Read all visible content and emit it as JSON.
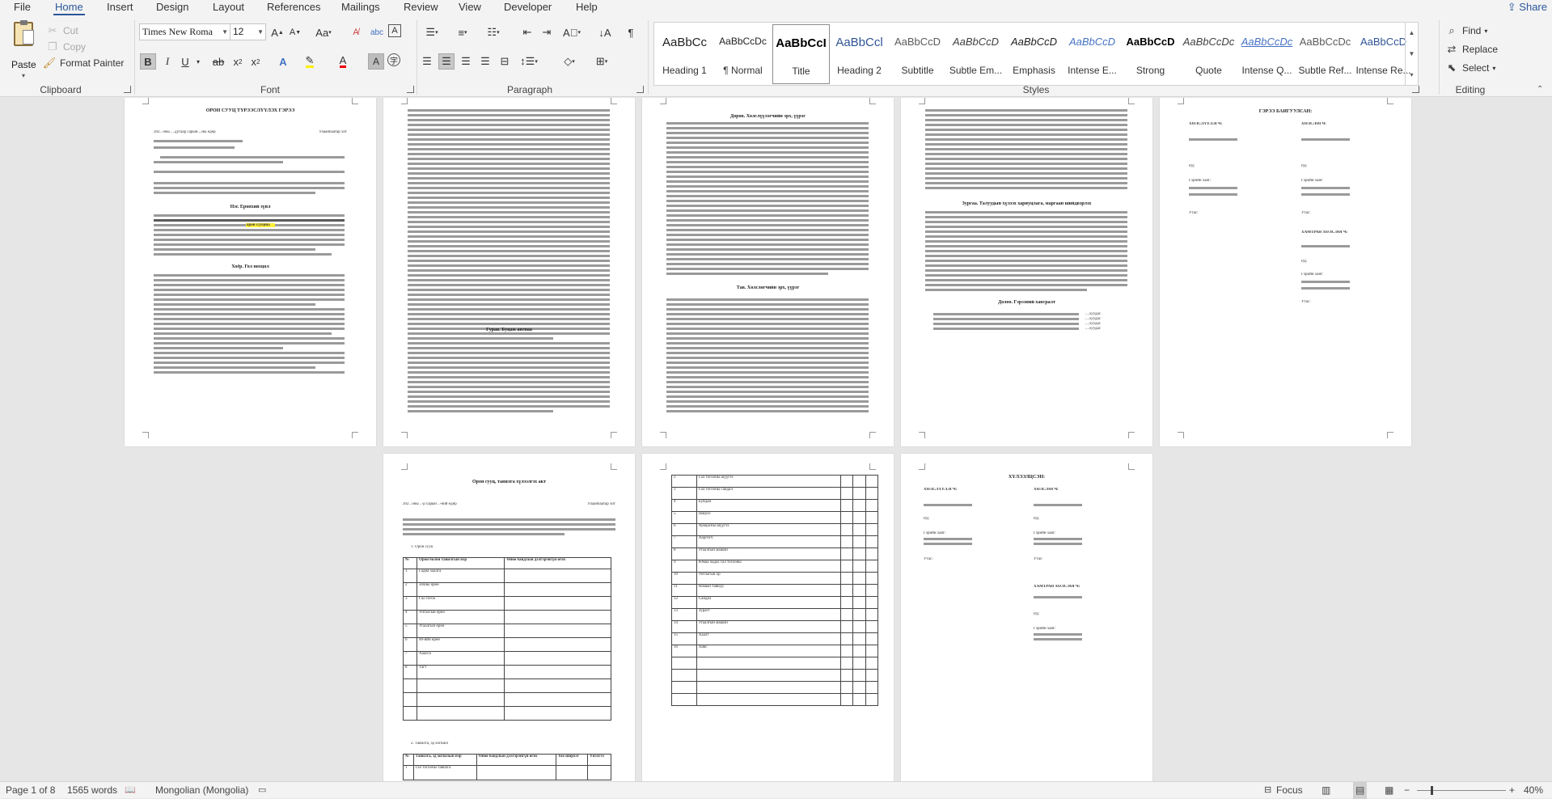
{
  "menu": {
    "tabs": [
      "File",
      "Home",
      "Insert",
      "Design",
      "Layout",
      "References",
      "Mailings",
      "Review",
      "View",
      "Developer",
      "Help"
    ],
    "active": "Home",
    "share": "Share"
  },
  "clipboard": {
    "paste": "Paste",
    "cut": "Cut",
    "copy": "Copy",
    "format_painter": "Format Painter",
    "label": "Clipboard"
  },
  "font": {
    "family": "Times New Roma",
    "size": "12",
    "label": "Font",
    "bold": "B",
    "italic": "I",
    "underline": "U",
    "aa": "Aa"
  },
  "paragraph": {
    "label": "Paragraph"
  },
  "styles": {
    "label": "Styles",
    "items": [
      {
        "preview": "AaBbCc",
        "name": "Heading 1",
        "color": "#1f1f1f"
      },
      {
        "preview": "AaBbCcDc",
        "name": "¶ Normal",
        "color": "#1f1f1f"
      },
      {
        "preview": "AaBbCcI",
        "name": "Title",
        "color": "#000000"
      },
      {
        "preview": "AaBbCcl",
        "name": "Heading 2",
        "color": "#2f5496"
      },
      {
        "preview": "AaBbCcD",
        "name": "Subtitle",
        "color": "#5a5a5a"
      },
      {
        "preview": "AaBbCcD",
        "name": "Subtle Em...",
        "color": "#404040"
      },
      {
        "preview": "AaBbCcD",
        "name": "Emphasis",
        "color": "#1f1f1f"
      },
      {
        "preview": "AaBbCcD",
        "name": "Intense E...",
        "color": "#4472c4"
      },
      {
        "preview": "AaBbCcD",
        "name": "Strong",
        "color": "#000000"
      },
      {
        "preview": "AaBbCcDc",
        "name": "Quote",
        "color": "#404040"
      },
      {
        "preview": "AaBbCcDc",
        "name": "Intense Q...",
        "color": "#4472c4"
      },
      {
        "preview": "AaBbCcDc",
        "name": "Subtle Ref...",
        "color": "#5a5a5a"
      },
      {
        "preview": "AaBbCcD",
        "name": "Intense Re...",
        "color": "#2f5496"
      }
    ]
  },
  "editing": {
    "label": "Editing",
    "find": "Find",
    "replace": "Replace",
    "select": "Select"
  },
  "pages": {
    "p1": {
      "title": "ОРОН СУУЦ ТҮРЭЭСЛҮҮЛЭХ ГЭРЭЭ",
      "date_line": "202.. оны ....дугаар сарын....ны өдөр",
      "place": "Улаанбаатар хот",
      "sec1": "Нэг. Ерөнхий зүйл",
      "sec2": "Хоёр. Гол нөхцөл",
      "highlight": "орон сууцны"
    },
    "p2": {
      "sec3": "Гурав. Буцаж авснаа"
    },
    "p3": {
      "sec4": "Дөрөв. Хөлслүүлэгчийн эрх, үүрэг",
      "sec5": "Тав. Хөлслөгчийн эрх, үүрэг"
    },
    "p4": {
      "sec6": "Зургаа. Талуудын хүлээх хариуцлага, маргаан шийдвэрлэх",
      "sec7": "Долоо. Гэрээний хавсралт",
      "items": [
        "....хуудас",
        "....хуудас",
        "....хуудас",
        "....хуудас"
      ]
    },
    "p5": {
      "title": "ГЭРЭЭ БАЙГУУЛСАН:",
      "left": "ХӨЛСЛҮҮЛЭГЧ:",
      "right": "ХӨЛСЛӨГЧ:",
      "rd": "РД:",
      "phone": "Гэрийн хаяг:",
      "sign": "Утас:",
      "third": "ХАМТРАН ХӨЛСЛӨГЧ:"
    },
    "p6": {
      "title": "Орон сууц, тавилга хүлээлгэх акт",
      "date_line": "202.. оны ..-р сарын ..-ний өдөр",
      "place": "Улаанбаатар хот",
      "list1": "1.   Орон сууц",
      "list2": "2.   Тавилга, эд хогшил",
      "t1_head": [
        "№",
        "Орон болон тавилгын нэр",
        "Өнөө байдлын дэлгэрэнгүй өгөх"
      ],
      "t1_rows": [
        [
          "1",
          "Гадна хаалга"
        ],
        [
          "2",
          "Зочны өрөө"
        ],
        [
          "3",
          "Гал тогоо"
        ],
        [
          "4",
          "Унтлагын өрөө"
        ],
        [
          "5",
          "Угаалгын өрөө"
        ],
        [
          "6",
          "00-ийн өрөө"
        ],
        [
          "7",
          "Хаалга"
        ],
        [
          "8",
          "Тагт"
        ]
      ],
      "t2_head": [
        "№",
        "Тавилга, эд хогшлын нэр",
        "Өнөө байдлын дэлгэрэнгүй өгөх",
        "Тоо ширхэг",
        "Үнэлгээ"
      ],
      "t2_rows": [
        [
          "1",
          "Гал тогооны тавилга"
        ]
      ]
    },
    "p7": {
      "rows": [
        [
          "2",
          "Гал тогооны шүүгээ"
        ],
        [
          "3",
          "Гал тогооны сандал"
        ],
        [
          "4",
          "Буйдан"
        ],
        [
          "5",
          "Ширээ"
        ],
        [
          "6",
          "Хувцасны шүүгээ"
        ],
        [
          "7",
          "Хөргөгч"
        ],
        [
          "8",
          "Угаалгын машин"
        ],
        [
          "9",
          "Юмаа чадах гал тогооны"
        ],
        [
          "10",
          "Унтлагын ор"
        ],
        [
          "11",
          "Номын тавиур"
        ],
        [
          "12",
          "Сандал"
        ],
        [
          "13",
          "Зурагт"
        ],
        [
          "14",
          "Угаалгын машин"
        ],
        [
          "15",
          "Хаалт"
        ],
        [
          "16",
          "Хивс"
        ]
      ]
    },
    "p8": {
      "title": "ХҮЛЭЭЛЦСЭН:",
      "left": "ХӨЛСЛҮҮЛЭГЧ:",
      "right": "ХӨЛСЛӨГЧ:",
      "rd": "РД:",
      "phone": "Гэрийн хаяг:",
      "sign": "Утас:",
      "third": "ХАМТРАН ХӨЛСЛӨГЧ:"
    }
  },
  "status": {
    "page": "Page 1 of 8",
    "words": "1565 words",
    "language": "Mongolian (Mongolia)",
    "focus": "Focus",
    "zoom": "40%",
    "zoom_minus": "−",
    "zoom_plus": "+"
  }
}
